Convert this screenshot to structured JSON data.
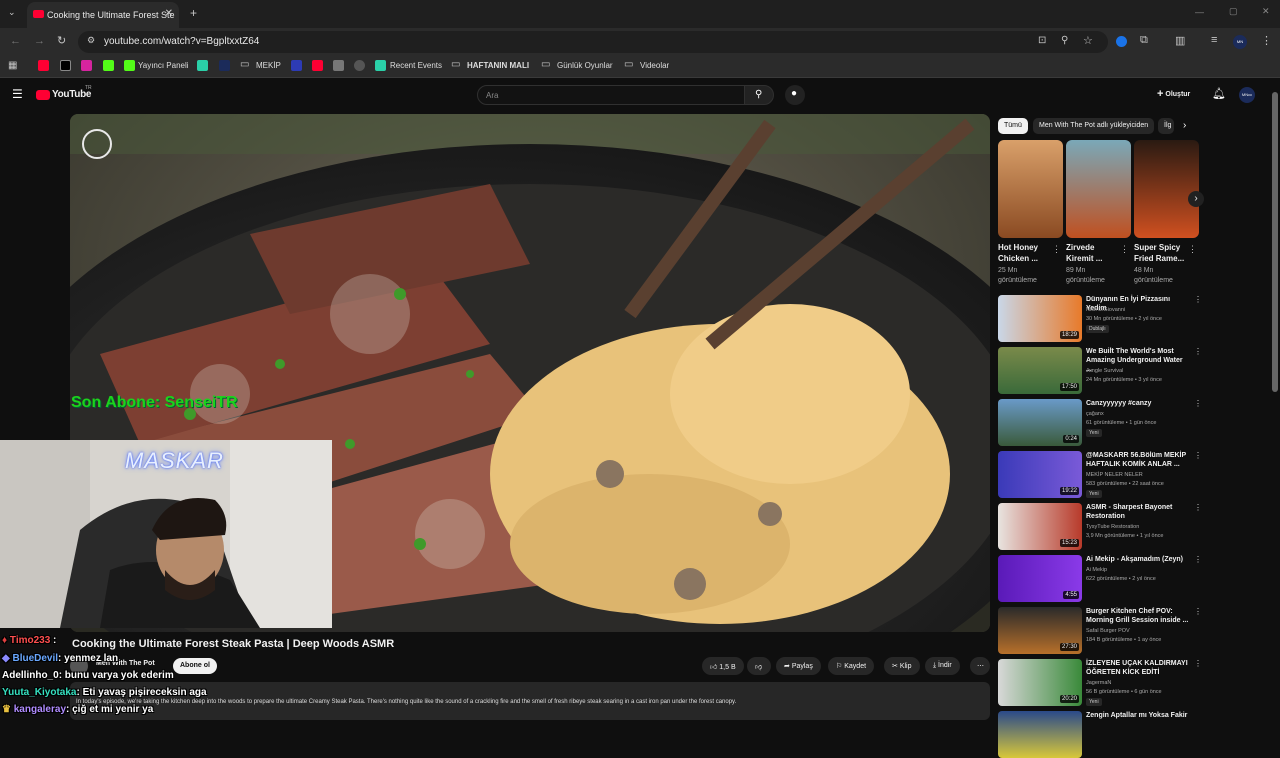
{
  "browser": {
    "tab_title": "Cooking the Ultimate Forest Ste",
    "url": "youtube.com/watch?v=BgpltxxtZ64",
    "bookmarks": [
      "Yayıncı Paneli",
      "MEKİP",
      "Recent Events",
      "HAFTANIN MALI",
      "Günlük Oyunlar",
      "Videolar"
    ]
  },
  "youtube": {
    "logo_text": "YouTube",
    "logo_country": "TR",
    "search_placeholder": "Ara",
    "create_label": "Oluştur",
    "avatar_label": "MNcc"
  },
  "video": {
    "overlay_text": "Son Abone: SenseiTR",
    "title": "Cooking the Ultimate Forest Steak Pasta | Deep Woods ASMR",
    "channel": "Men With The Pot",
    "subscribe_label": "Abone ol",
    "like_count": "1,5 B",
    "share_label": "Paylaş",
    "save_label": "Kaydet",
    "clip_label": "Klip",
    "download_label": "İndir",
    "description": "In today's episode, we're taking the kitchen deep into the woods to prepare the ultimate Creamy Steak Pasta. There's nothing quite like the sound of a crackling fire and the smell of fresh ribeye steak searing in a cast iron pan under the forest canopy."
  },
  "chips": [
    "Tümü",
    "Men With The Pot adlı yükleyiciden",
    "İlg"
  ],
  "shorts": [
    {
      "title": "Hot Honey Chicken ...",
      "views": "25 Mn görüntüleme"
    },
    {
      "title": "Zirvede Kiremit ...",
      "views": "89 Mn görüntüleme"
    },
    {
      "title": "Super Spicy Fried Rame...",
      "views": "48 Mn görüntüleme"
    }
  ],
  "recommendations": [
    {
      "title": "Dünyanın En İyi Pizzasını Yedim",
      "channel": "Nick DiGiovanni",
      "meta": "30 Mn görüntüleme • 2 yıl önce",
      "duration": "18:29",
      "badge": "Dublajlı"
    },
    {
      "title": "We Built The World's Most Amazing Underground Water ...",
      "channel": "Jungle Survival",
      "meta": "24 Mn görüntüleme • 3 yıl önce",
      "duration": "17:50",
      "badge": ""
    },
    {
      "title": "Canzyyyyyy #canzy",
      "channel": "çağanx",
      "meta": "61 görüntüleme • 1 gün önce",
      "duration": "0:24",
      "badge": "Yeni"
    },
    {
      "title": "@MASKARR 56.Bölüm MEKİP HAFTALIK KOMİK ANLAR ...",
      "channel": "MEKİP NELER NELER",
      "meta": "583 görüntüleme • 22 saat önce",
      "duration": "19:22",
      "badge": "Yeni"
    },
    {
      "title": "ASMR - Sharpest Bayonet Restoration",
      "channel": "TysyTube Restoration",
      "meta": "3,9 Mn görüntüleme • 1 yıl önce",
      "duration": "15:23",
      "badge": ""
    },
    {
      "title": "Ai Mekip - Akşamadım (Zeyn)",
      "channel": "Ai Mekip",
      "meta": "622 görüntüleme • 2 yıl önce",
      "duration": "4:55",
      "badge": ""
    },
    {
      "title": "Burger Kitchen Chef POV: Morning Grill Session inside ...",
      "channel": "Safal Burger POV",
      "meta": "184 B görüntüleme • 1 ay önce",
      "duration": "27:30",
      "badge": ""
    },
    {
      "title": "İZLEYENE UÇAK KALDIRMAYI ÖĞRETEN KİCK EDİTİ",
      "channel": "JagermaN",
      "meta": "56 B görüntüleme • 6 gün önce",
      "duration": "20:20",
      "badge": "Yeni"
    },
    {
      "title": "Zengin Aptallar mı Yoksa Fakir",
      "channel": "",
      "meta": "",
      "duration": "",
      "badge": ""
    }
  ],
  "stream": {
    "webcam_name": "MASKAR",
    "chat": [
      {
        "user": "Timo233",
        "msg": "",
        "color": "#ff4f4f"
      },
      {
        "user": "BlueDevil",
        "msg": ": yenmez lan",
        "color": "#6aa8ff"
      },
      {
        "user": "Adellinho_0",
        "msg": ": bunu varya yok ederim",
        "color": "#ffffff"
      },
      {
        "user": "Yuuta_Kiyotaka",
        "msg": ": Eti yavaş pişireceksin aga",
        "color": "#35e0c0"
      },
      {
        "user": "kangaleray",
        "msg": ": çiğ et mi yenir ya",
        "color": "#b08cff"
      }
    ]
  }
}
